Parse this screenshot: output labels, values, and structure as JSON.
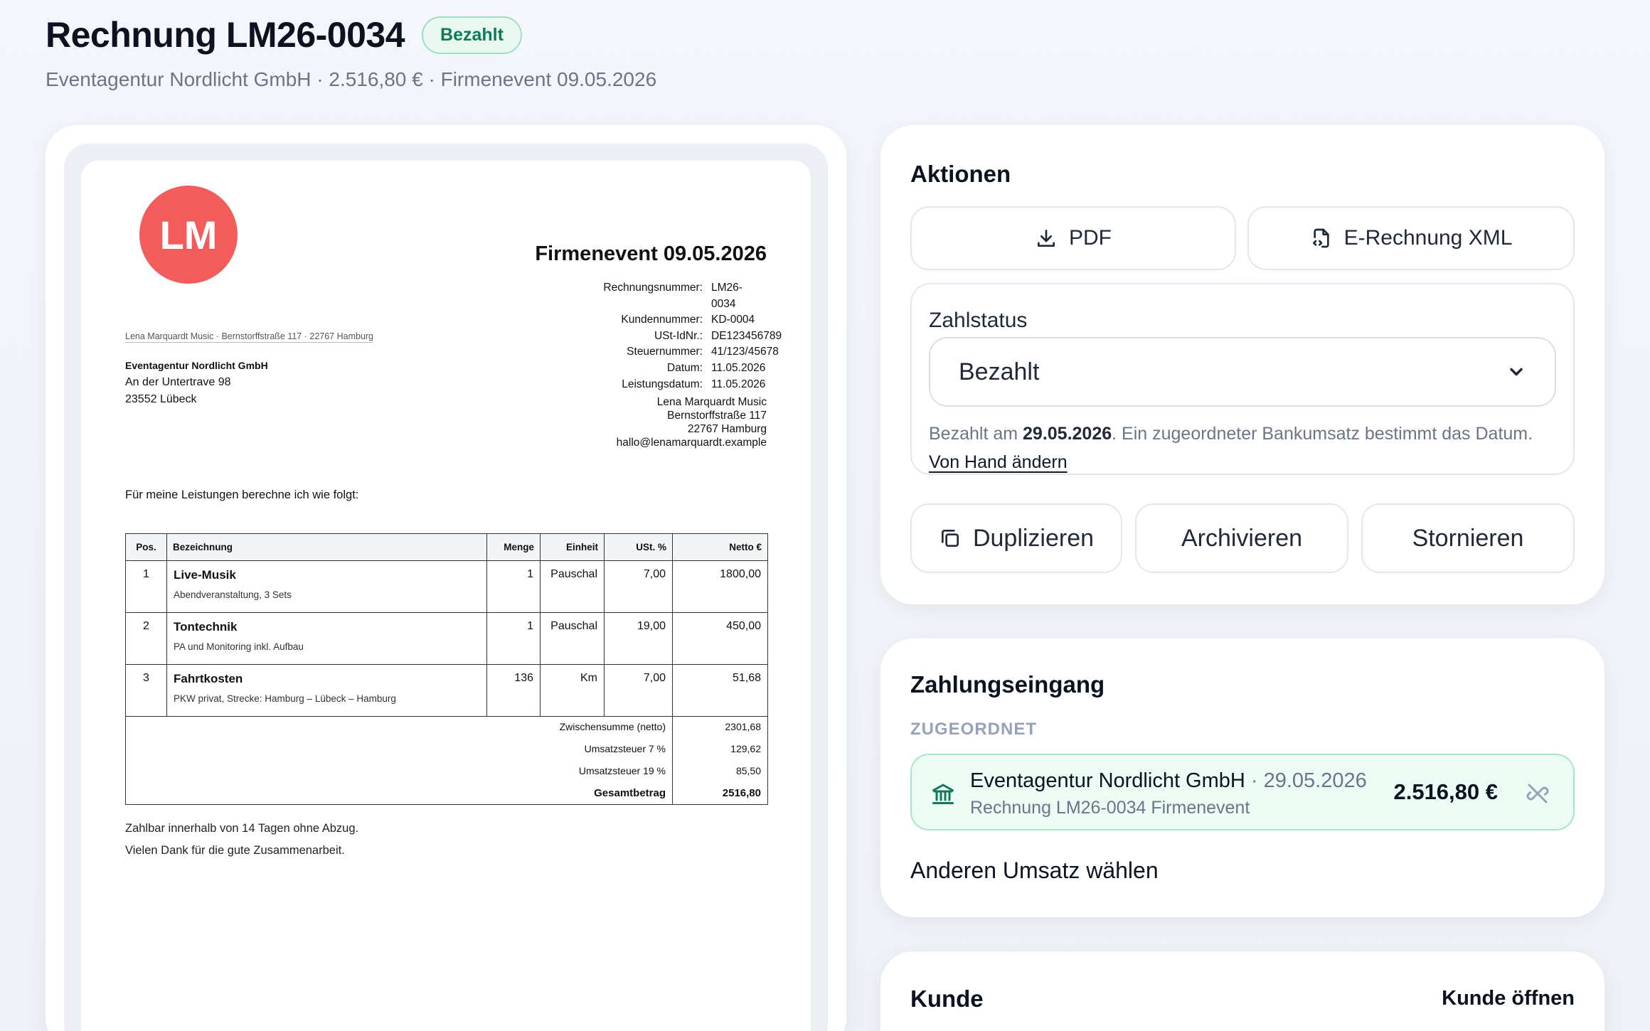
{
  "header": {
    "title": "Rechnung LM26-0034",
    "badge": "Bezahlt",
    "subtitle": "Eventagentur Nordlicht GmbH · 2.516,80 € · Firmenevent 09.05.2026"
  },
  "invoice": {
    "logo_text": "LM",
    "title": "Firmenevent 09.05.2026",
    "meta": [
      {
        "label": "Rechnungsnummer:",
        "value": "LM26-0034"
      },
      {
        "label": "Kundennummer:",
        "value": "KD-0004"
      },
      {
        "label": "USt-IdNr.:",
        "value": "DE123456789"
      },
      {
        "label": "Steuernummer:",
        "value": "41/123/45678"
      },
      {
        "label": "Datum:",
        "value": "11.05.2026"
      },
      {
        "label": "Leistungsdatum:",
        "value": "11.05.2026"
      }
    ],
    "sender_line": "Lena Marquardt Music · Bernstorffstraße 117 · 22767 Hamburg",
    "recipient": {
      "name": "Eventagentur Nordlicht GmbH",
      "street": "An der Untertrave 98",
      "city": "23552 Lübeck"
    },
    "sender": {
      "name": "Lena Marquardt Music",
      "street": "Bernstorffstraße 117",
      "city": "22767 Hamburg",
      "email": "hallo@lenamarquardt.example"
    },
    "intro": "Für meine Leistungen berechne ich wie folgt:",
    "columns": {
      "pos": "Pos.",
      "desc": "Bezeichnung",
      "qty": "Menge",
      "unit": "Einheit",
      "vat": "USt. %",
      "net": "Netto €"
    },
    "items": [
      {
        "pos": "1",
        "title": "Live-Musik",
        "sub": "Abendveranstaltung, 3 Sets",
        "qty": "1",
        "unit": "Pauschal",
        "vat": "7,00",
        "net": "1800,00"
      },
      {
        "pos": "2",
        "title": "Tontechnik",
        "sub": "PA und Monitoring inkl. Aufbau",
        "qty": "1",
        "unit": "Pauschal",
        "vat": "19,00",
        "net": "450,00"
      },
      {
        "pos": "3",
        "title": "Fahrtkosten",
        "sub": "PKW privat, Strecke: Hamburg – Lübeck – Hamburg",
        "qty": "136",
        "unit": "Km",
        "vat": "7,00",
        "net": "51,68"
      }
    ],
    "totals": [
      {
        "label": "Zwischensumme (netto)",
        "value": "2301,68"
      },
      {
        "label": "Umsatzsteuer 7 %",
        "value": "129,62"
      },
      {
        "label": "Umsatzsteuer 19 %",
        "value": "85,50"
      },
      {
        "label": "Gesamtbetrag",
        "value": "2516,80"
      }
    ],
    "footer": [
      "Zahlbar innerhalb von 14 Tagen ohne Abzug.",
      "Vielen Dank für die gute Zusammenarbeit."
    ]
  },
  "actions": {
    "title": "Aktionen",
    "pdf_label": "PDF",
    "xml_label": "E-Rechnung XML",
    "status_label": "Zahlstatus",
    "status_value": "Bezahlt",
    "status_note_prefix": "Bezahlt am ",
    "status_note_date": "29.05.2026",
    "status_note_suffix": ". Ein zugeordneter Bankumsatz bestimmt das Datum.",
    "manual_link": "Von Hand ändern",
    "duplicate_label": "Duplizieren",
    "archive_label": "Archivieren",
    "cancel_label": "Stornieren"
  },
  "payment": {
    "title": "Zahlungseingang",
    "assigned_label": "ZUGEORDNET",
    "name": "Eventagentur Nordlicht GmbH",
    "date": " · 29.05.2026",
    "reference": "Rechnung LM26-0034 Firmenevent",
    "amount": "2.516,80 €",
    "other_link": "Anderen Umsatz wählen"
  },
  "customer": {
    "title": "Kunde",
    "open_link": "Kunde öffnen"
  },
  "colors": {
    "accent_green": "#0f7a55",
    "logo_red": "#f45b5b"
  }
}
